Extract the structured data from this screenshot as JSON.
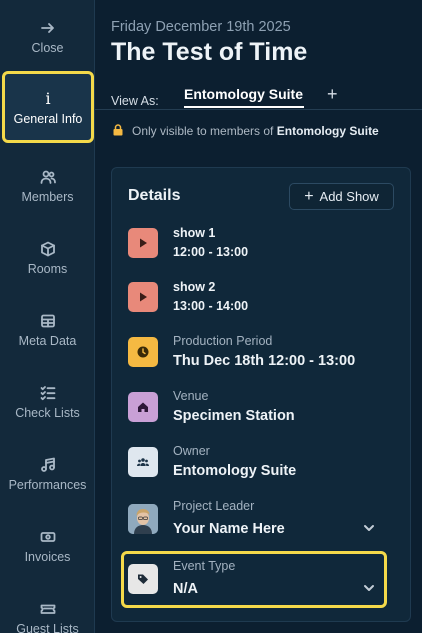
{
  "sidebar": {
    "items": [
      {
        "label": "Close",
        "icon": "arrow-right-icon"
      },
      {
        "label": "General Info",
        "icon": "info-icon",
        "glyph": "i"
      },
      {
        "label": "Members",
        "icon": "members-icon"
      },
      {
        "label": "Rooms",
        "icon": "cube-icon"
      },
      {
        "label": "Meta Data",
        "icon": "table-icon"
      },
      {
        "label": "Check Lists",
        "icon": "checklist-icon"
      },
      {
        "label": "Performances",
        "icon": "music-icon"
      },
      {
        "label": "Invoices",
        "icon": "money-icon"
      },
      {
        "label": "Guest Lists",
        "icon": "ticket-icon"
      }
    ]
  },
  "header": {
    "date": "Friday December 19th 2025",
    "title": "The Test of Time",
    "view_as_label": "View As:",
    "active_tab": "Entomology Suite",
    "add_tab": "+",
    "visibility_prefix": "Only visible to members of",
    "visibility_group": "Entomology Suite"
  },
  "details": {
    "title": "Details",
    "add_show_label": "Add Show",
    "shows": [
      {
        "name": "show 1",
        "time": "12:00 - 13:00"
      },
      {
        "name": "show 2",
        "time": "13:00 - 14:00"
      }
    ],
    "production_period": {
      "label": "Production Period",
      "value": "Thu Dec 18th 12:00 - 13:00"
    },
    "venue": {
      "label": "Venue",
      "value": "Specimen Station"
    },
    "owner": {
      "label": "Owner",
      "value": "Entomology Suite"
    },
    "project_leader": {
      "label": "Project Leader",
      "value": "Your Name Here"
    },
    "event_type": {
      "label": "Event Type",
      "value": "N/A"
    }
  },
  "colors": {
    "show_icon_bg": "#e8897a",
    "period_icon_bg": "#f5b942",
    "venue_icon_bg": "#c9a0d6",
    "owner_icon_bg": "#dfe7ef",
    "event_icon_bg": "#e7e7e7",
    "highlight": "#f4d94a"
  }
}
